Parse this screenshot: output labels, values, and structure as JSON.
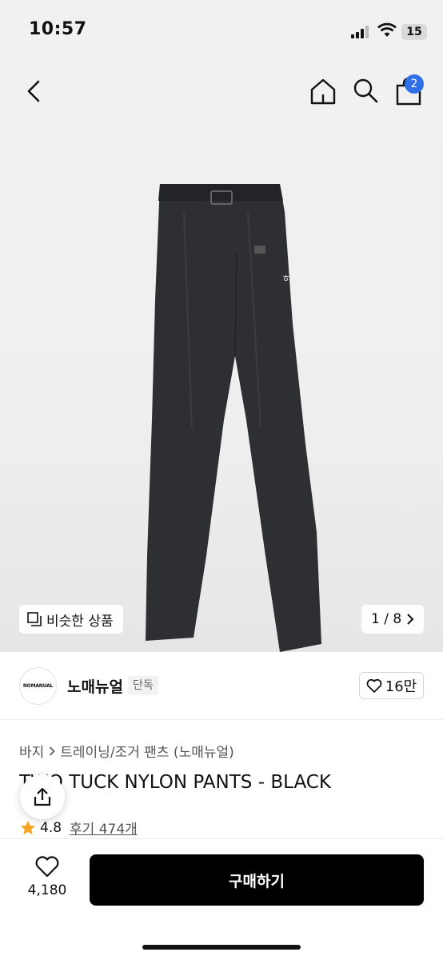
{
  "status": {
    "time": "10:57",
    "battery": "15"
  },
  "nav": {
    "cart_count": "2",
    "icons": [
      "back-arrow-icon",
      "home-icon",
      "search-icon",
      "shopping-bag-icon"
    ]
  },
  "gallery": {
    "similar_label": "비슷한 상품",
    "page_indicator": "1 / 8"
  },
  "brand": {
    "logo_text": "NOMANUAL",
    "name": "노매뉴얼",
    "tag": "단독",
    "likes": "16만"
  },
  "breadcrumb": {
    "category": "바지",
    "subcategory": "트레이닝/조거 팬츠 (노매뉴얼)"
  },
  "product": {
    "title": "TWO TUCK NYLON PANTS - BLACK",
    "rating": "4.8",
    "reviews": "후기 474개"
  },
  "bottom": {
    "wish_count": "4,180",
    "buy_label": "구매하기"
  },
  "colors": {
    "badge": "#2f6fe8",
    "star": "#f5a623",
    "buy_button": "#000000"
  }
}
